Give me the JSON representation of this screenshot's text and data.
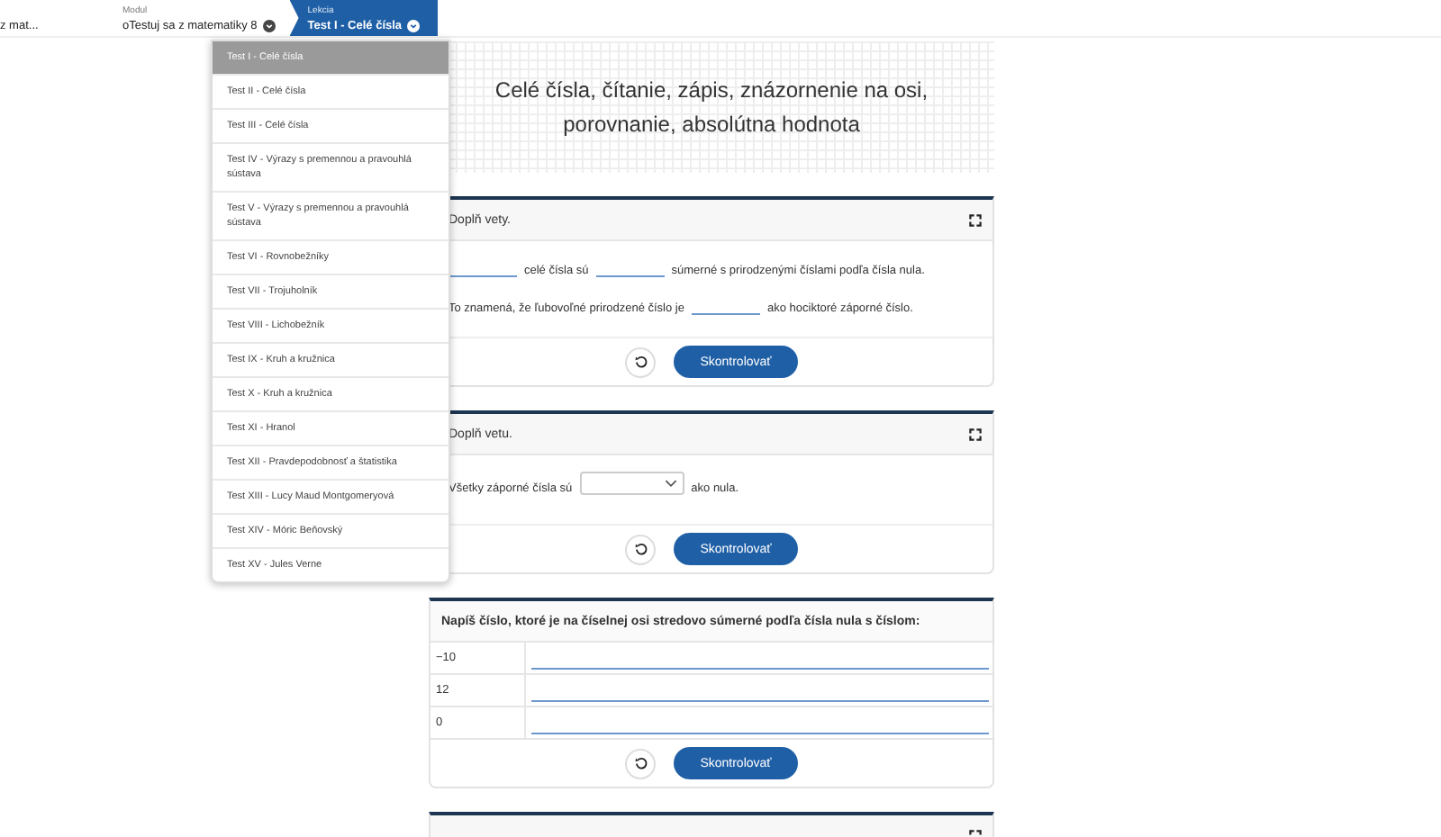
{
  "breadcrumb": [
    {
      "value": "z mat...",
      "selected": false,
      "has_menu": false
    },
    {
      "label": "Modul",
      "value": "oTestuj sa z matematiky 8",
      "selected": false,
      "has_menu": true
    },
    {
      "label": "Lekcia",
      "value": "Test I - Celé čísla",
      "selected": true,
      "has_menu": true
    }
  ],
  "lesson_menu": {
    "items": [
      {
        "label": "Test I - Celé čísla",
        "selected": true
      },
      {
        "label": "Test II - Celé čísla",
        "selected": false
      },
      {
        "label": "Test III - Celé čísla",
        "selected": false
      },
      {
        "label": "Test IV - Výrazy s premennou a pravouhlá sústava",
        "selected": false
      },
      {
        "label": "Test V - Výrazy s premennou a pravouhlá sústava",
        "selected": false
      },
      {
        "label": "Test VI - Rovnobežníky",
        "selected": false
      },
      {
        "label": "Test VII - Trojuholník",
        "selected": false
      },
      {
        "label": "Test VIII - Lichobežník",
        "selected": false
      },
      {
        "label": "Test IX - Kruh a kružnica",
        "selected": false
      },
      {
        "label": "Test X - Kruh a kružnica",
        "selected": false
      },
      {
        "label": "Test XI - Hranol",
        "selected": false
      },
      {
        "label": "Test XII - Pravdepodobnosť a štatistika",
        "selected": false
      },
      {
        "label": "Test XIII - Lucy Maud Montgomeryová",
        "selected": false
      },
      {
        "label": "Test XIV - Móric Beňovský",
        "selected": false
      },
      {
        "label": "Test XV - Jules Verne",
        "selected": false
      }
    ]
  },
  "page_title": "Celé čísla, čítanie, zápis, znázornenie na osi, porovnanie, absolútna hodnota",
  "exercises": [
    {
      "kind": "blanks",
      "title": "Doplň vety.",
      "lines": [
        [
          {
            "kind": "blank"
          },
          {
            "kind": "text",
            "text": "celé čísla sú"
          },
          {
            "kind": "blank"
          },
          {
            "kind": "text",
            "text": "súmerné s  prirodzenými číslami podľa čísla nula."
          }
        ],
        [
          {
            "kind": "text",
            "text": "To znamená, že ľubovoľné prirodzené číslo je"
          },
          {
            "kind": "blank"
          },
          {
            "kind": "text",
            "text": "ako hociktoré záporné číslo."
          }
        ]
      ],
      "check_label": "Skontrolovať"
    },
    {
      "kind": "select",
      "title": "Doplň vetu.",
      "lines": [
        [
          {
            "kind": "text",
            "text": "Všetky záporné čísla sú"
          },
          {
            "kind": "select"
          },
          {
            "kind": "text",
            "text": "ako nula."
          }
        ]
      ],
      "check_label": "Skontrolovať"
    },
    {
      "kind": "table",
      "title": "Napíš číslo, ktoré je na číselnej osi stredovo súmerné podľa čísla nula s číslom:",
      "rows": [
        "−10",
        "12",
        "0"
      ],
      "check_label": "Skontrolovať"
    },
    {
      "kind": "partial"
    }
  ]
}
